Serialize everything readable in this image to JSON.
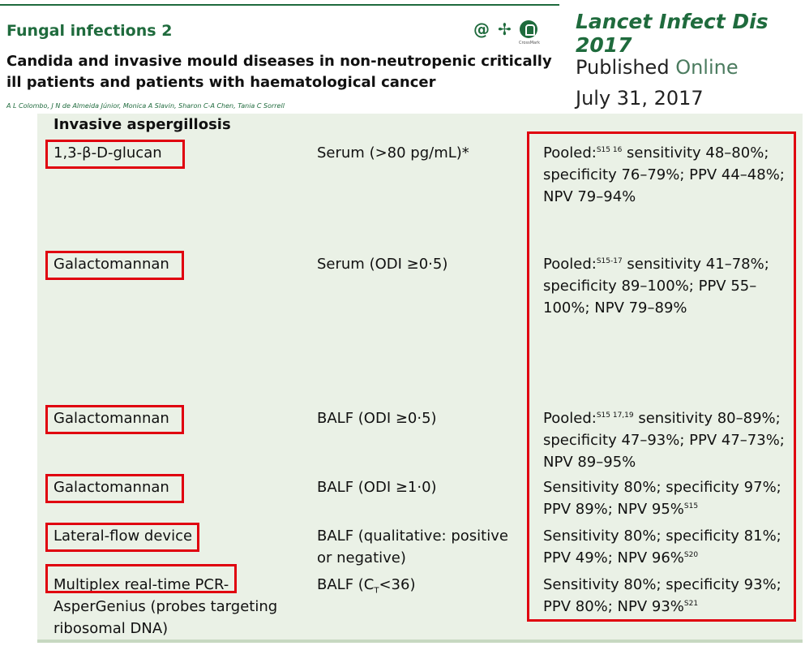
{
  "header": {
    "series": "Fungal infections 2",
    "title": "Candida and invasive mould diseases in non-neutropenic critically ill patients and patients with haematological cancer",
    "authors": "A L Colombo, J N de Almeida Júnior, Monica A Slavin, Sharon C-A Chen, Tania C Sorrell",
    "icons": [
      "at-icon",
      "pointer-icon",
      "crossmark-icon"
    ],
    "crossmark_caption": "CrossMark"
  },
  "citation": {
    "journal": "Lancet Infect Dis 2017",
    "published": "Published",
    "online": "Online",
    "date": "July 31, 2017"
  },
  "table": {
    "section": "Invasive aspergillosis",
    "rows": [
      {
        "test": "1,3-β-D-glucan",
        "sample": "Serum (>80 pg/mL)*",
        "perf_prefix": "Pooled:",
        "perf_ref": "S15 16",
        "perf_text": " sensitivity 48–80%; specificity 76–79%; PPV 44–48%; NPV 79–94%"
      },
      {
        "test": "Galactomannan",
        "sample": "Serum (ODI ≥0·5)",
        "perf_prefix": "Pooled:",
        "perf_ref": "S15-17",
        "perf_text": " sensitivity 41–78%; specificity 89–100%; PPV 55–100%; NPV 79–89%"
      },
      {
        "test": "Galactomannan",
        "sample": "BALF (ODI ≥0·5)",
        "perf_prefix": "Pooled:",
        "perf_ref": "S15 17,19",
        "perf_text": " sensitivity 80–89%; specificity 47–93%; PPV 47–73%; NPV 89–95%"
      },
      {
        "test": "Galactomannan",
        "sample": "BALF (ODI ≥1·0)",
        "perf_text": "Sensitivity 80%; specificity 97%; PPV 89%; NPV 95%",
        "perf_ref": "S15"
      },
      {
        "test": "Lateral-flow device",
        "sample": "BALF (qualitative: positive or negative)",
        "perf_text": "Sensitivity 80%; specificity 81%; PPV 49%; NPV 96%",
        "perf_ref": "S20"
      },
      {
        "test": "Multiplex real-time PCR-",
        "test_cont": "AsperGenius (probes targeting ribosomal DNA)",
        "sample_prefix": "BALF (C",
        "sample_sub": "T",
        "sample_suffix": "<36)",
        "perf_text": "Sensitivity 80%; specificity 93%; PPV 80%; NPV 93%",
        "perf_ref": "S21"
      }
    ]
  },
  "colors": {
    "brand_green": "#1f6b3d",
    "highlight_red": "#e0000f",
    "table_bg": "#eaf1e6"
  }
}
